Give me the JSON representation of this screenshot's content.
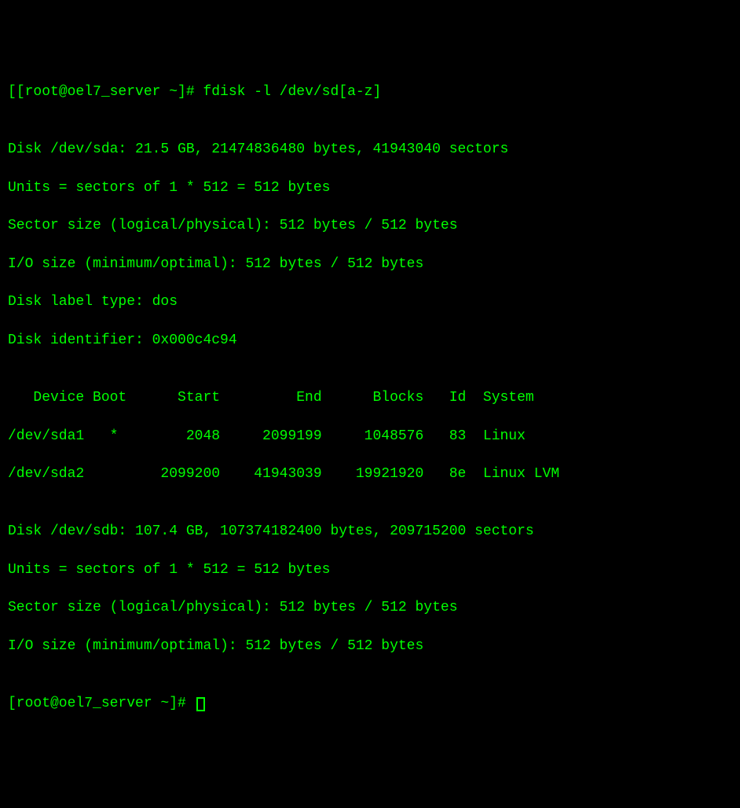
{
  "prompt1": {
    "prefix": "[",
    "user_host": "[root@oel7_server ~]# ",
    "command": "fdisk -l /dev/sd[a-z]"
  },
  "blank": "",
  "sda": {
    "header": "Disk /dev/sda: 21.5 GB, 21474836480 bytes, 41943040 sectors",
    "units": "Units = sectors of 1 * 512 = 512 bytes",
    "sector_size": "Sector size (logical/physical): 512 bytes / 512 bytes",
    "io_size": "I/O size (minimum/optimal): 512 bytes / 512 bytes",
    "label_type": "Disk label type: dos",
    "identifier": "Disk identifier: 0x000c4c94"
  },
  "table": {
    "header": "   Device Boot      Start         End      Blocks   Id  System",
    "row1": "/dev/sda1   *        2048     2099199     1048576   83  Linux",
    "row2": "/dev/sda2         2099200    41943039    19921920   8e  Linux LVM"
  },
  "sdb": {
    "header": "Disk /dev/sdb: 107.4 GB, 107374182400 bytes, 209715200 sectors",
    "units": "Units = sectors of 1 * 512 = 512 bytes",
    "sector_size": "Sector size (logical/physical): 512 bytes / 512 bytes",
    "io_size": "I/O size (minimum/optimal): 512 bytes / 512 bytes"
  },
  "prompt2": {
    "user_host": "[root@oel7_server ~]# "
  }
}
